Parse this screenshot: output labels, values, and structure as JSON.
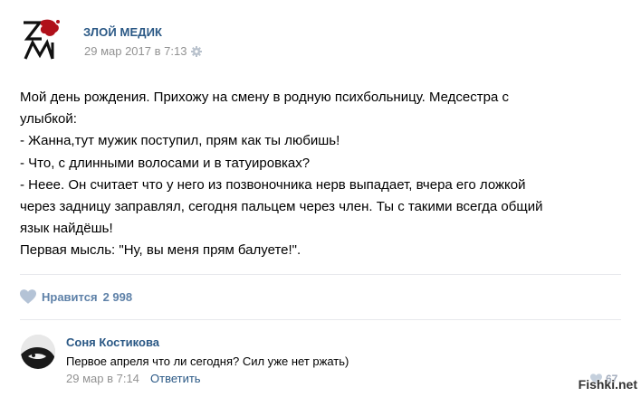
{
  "post": {
    "author": "ЗЛОЙ МЕДИК",
    "date": "29 мар 2017 в 7:13",
    "lines": [
      "Мой день рождения. Прихожу на смену в родную психбольницу. Медсестра с",
      "улыбкой:",
      "- Жанна,тут мужик поступил, прям как ты любишь!",
      "- Что, с длинными волосами и в татуировках?",
      "- Нееe. Он считает что у него из позвоночника нерв выпадает, вчера его ложкой",
      "через задницу заправлял, сегодня пальцем через член. Ты с такими всегда общий",
      "язык найдёшь!",
      "Первая мысль: \"Ну, вы меня прям балуете!\"."
    ],
    "like_label": "Нравится",
    "like_count": "2 998"
  },
  "comment": {
    "author": "Соня Костикова",
    "text": "Первое апреля что ли сегодня? Сил уже нет ржать)",
    "date": "29 мар в 7:14",
    "reply_label": "Ответить",
    "like_count": "67"
  },
  "watermark": "Fishki.net",
  "icons": {
    "logo": "zm-logo-icon",
    "gear": "gear-icon",
    "like": "heart-icon"
  },
  "colors": {
    "link": "#2a5885",
    "meta": "#939393",
    "like": "#5e81a8"
  }
}
